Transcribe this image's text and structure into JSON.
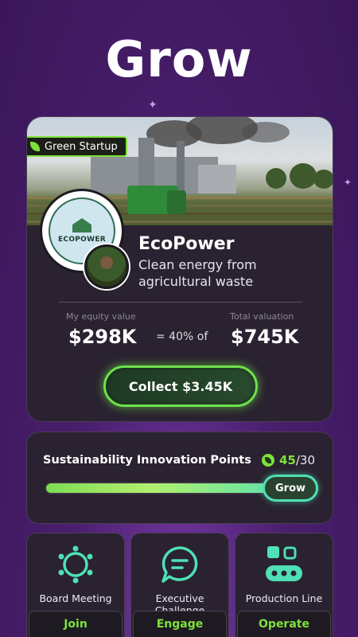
{
  "headline": "Grow",
  "card": {
    "tag_label": "Green Startup",
    "logo_text": "ECOPOWER",
    "company_name": "EcoPower",
    "company_desc": "Clean energy from agricultural waste",
    "equity_label": "My equity value",
    "equity_value": "$298K",
    "equity_mid": "= 40% of",
    "valuation_label": "Total valuation",
    "valuation_value": "$745K",
    "collect_label": "Collect $3.45K"
  },
  "points": {
    "title": "Sustainability Innovation Points",
    "current": "45",
    "target": "/30",
    "progress_fraction": 1.0,
    "grow_label": "Grow"
  },
  "tiles": [
    {
      "label": "Board Meeting",
      "action": "Join",
      "icon": "sun-network-icon"
    },
    {
      "label": "Executive Challenge",
      "action": "Engage",
      "icon": "chat-bubble-icon"
    },
    {
      "label": "Production Line",
      "action": "Operate",
      "icon": "conveyor-icon"
    }
  ],
  "colors": {
    "accent_green": "#7ee23a",
    "teal": "#4fe0b5",
    "card_bg": "#2a2230",
    "background": "#4a1f6e"
  }
}
